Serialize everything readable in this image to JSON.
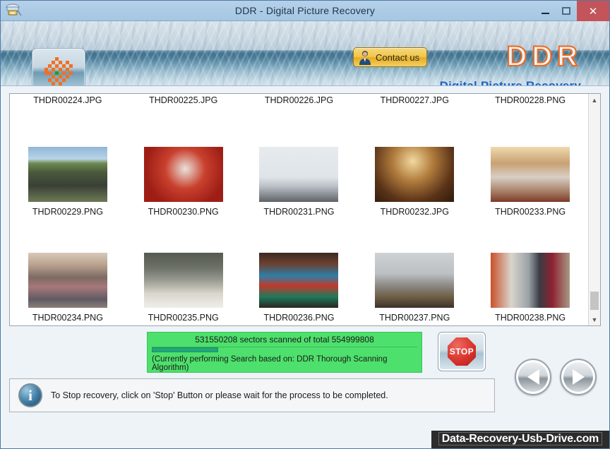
{
  "window": {
    "title": "DDR - Digital Picture Recovery",
    "app_icon": "camera-icon",
    "controls": {
      "minimize": "minimize-icon",
      "maximize": "maximize-icon",
      "close": "✕"
    }
  },
  "header": {
    "logo_tile_icon": "checkered-pattern-icon",
    "contact_button": {
      "label": "Contact us",
      "icon": "person-icon"
    },
    "brand": "DDR",
    "brand_subtitle": "Digital Picture Recovery",
    "brand_stroke_color": "#f2681b",
    "subtitle_color": "#1e63c4"
  },
  "thumbnails": {
    "rows": [
      {
        "labels_above": [
          "THDR00224.JPG",
          "THDR00225.JPG",
          "THDR00226.JPG",
          "THDR00227.JPG",
          "THDR00228.PNG"
        ],
        "items": [
          {
            "label": "THDR00229.PNG",
            "scene": "outdoor-motorcycle-crowd"
          },
          {
            "label": "THDR00230.PNG",
            "scene": "santa-and-child-red"
          },
          {
            "label": "THDR00231.PNG",
            "scene": "office-whiteboard-people"
          },
          {
            "label": "THDR00232.JPG",
            "scene": "dinner-banquet-table"
          },
          {
            "label": "THDR00233.PNG",
            "scene": "two-women-at-table"
          }
        ]
      },
      {
        "labels_above": [],
        "items": [
          {
            "label": "THDR00234.PNG",
            "scene": "large-group-photo"
          },
          {
            "label": "THDR00235.PNG",
            "scene": "banquet-hall-tables"
          },
          {
            "label": "THDR00236.PNG",
            "scene": "party-hats-group"
          },
          {
            "label": "THDR00237.PNG",
            "scene": "man-at-desk-christmas-tree"
          },
          {
            "label": "THDR00238.PNG",
            "scene": "couple-in-hallway"
          }
        ]
      }
    ],
    "scrollbar": {
      "up_arrow": "chevron-up-icon",
      "down_arrow": "chevron-down-icon"
    }
  },
  "progress": {
    "status_text": "531550208 sectors scanned of total 554999808",
    "sectors_scanned": 531550208,
    "sectors_total": 554999808,
    "percent": 25,
    "note": "(Currently performing Search based on:  DDR Thorough Scanning Algorithm)",
    "panel_color": "#4ee06c",
    "fill_color": "#21a877",
    "stop_button_label": "STOP"
  },
  "info": {
    "icon": "info-icon",
    "message": "To Stop recovery, click on 'Stop' Button or please wait for the process to be completed."
  },
  "navigation": {
    "back_label": "back-arrow",
    "next_label": "next-arrow"
  },
  "watermark": "Data-Recovery-Usb-Drive.com"
}
